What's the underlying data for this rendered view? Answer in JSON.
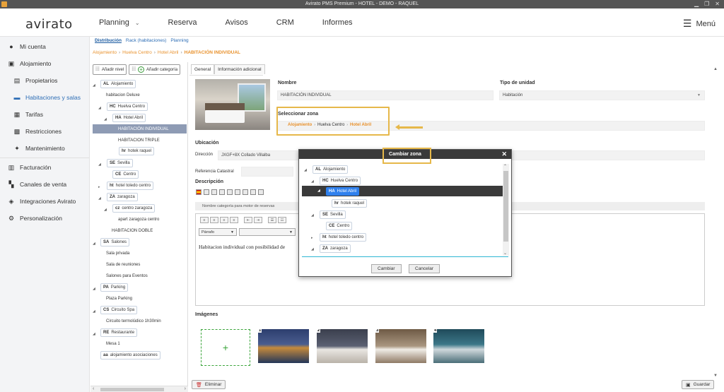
{
  "window": {
    "title": "Avirato PMS Premium - HOTEL - DEMO - RAQUEL"
  },
  "header": {
    "logo": "avirato",
    "nav": [
      "Planning",
      "Reserva",
      "Avisos",
      "CRM",
      "Informes"
    ],
    "menu_label": "Menú"
  },
  "sidebar": {
    "items": [
      {
        "label": "Mi cuenta",
        "icon": "user-icon"
      },
      {
        "label": "Alojamiento",
        "icon": "building-icon"
      },
      {
        "label": "Propietarios",
        "icon": "contact-icon"
      },
      {
        "label": "Habitaciones y salas",
        "icon": "bed-icon"
      },
      {
        "label": "Tarifas",
        "icon": "tariff-icon"
      },
      {
        "label": "Restricciones",
        "icon": "calendar-icon"
      },
      {
        "label": "Mantenimiento",
        "icon": "sparkle-icon"
      },
      {
        "label": "Facturación",
        "icon": "invoice-icon"
      },
      {
        "label": "Canales de venta",
        "icon": "grid-icon"
      },
      {
        "label": "Integraciones Avirato",
        "icon": "layers-icon"
      },
      {
        "label": "Personalización",
        "icon": "gear-icon"
      }
    ]
  },
  "subtabs": [
    "Distribución",
    "Rack (habitaciones)",
    "Planning"
  ],
  "breadcrumb": [
    "Alojamiento",
    "Huelva Centro",
    "Hotel Abril",
    "HABITACIÓN INDIVIDUAL"
  ],
  "tree": {
    "add_level": "Añadir nivel",
    "add_category": "Añadir categoría",
    "nodes": {
      "al": {
        "code": "AL",
        "label": "Alojamiento"
      },
      "hab_deluxe": "habitacion Deluxe",
      "hc": {
        "code": "HC",
        "label": "Huelva Centro"
      },
      "ha": {
        "code": "HA",
        "label": "Hotel Abril"
      },
      "hab_ind": "HABITACIÓN INDIVIDUAL",
      "hab_triple": "HABITACION TRIPLE",
      "hr": {
        "code": "hr",
        "label": "hotek raquel"
      },
      "se": {
        "code": "SE",
        "label": "Sevilla"
      },
      "ce": {
        "code": "CE",
        "label": "Centro"
      },
      "ht": {
        "code": "ht",
        "label": "hotel toledo centro"
      },
      "za": {
        "code": "ZA",
        "label": "zaragoza"
      },
      "cz": {
        "code": "cz",
        "label": "centro zaragoza"
      },
      "apart": "apart zaragoza centro",
      "hab_doble": "HABITACION DOBLE",
      "sa": {
        "code": "SA",
        "label": "Salones"
      },
      "sala_priv": "Sala privada",
      "sala_reun": "Sala de reuniones",
      "salones_ev": "Salones para Eventos",
      "pa": {
        "code": "PA",
        "label": "Parking"
      },
      "plaza": "Plaza Parking",
      "cs": {
        "code": "CS",
        "label": "Circuito Spa"
      },
      "circ_term": "Circuito termolúdico 1h30min",
      "re": {
        "code": "RE",
        "label": "Restaurante"
      },
      "mesa": "Mesa 1",
      "aa": {
        "code": "aa",
        "label": "alojamiento asociaciones"
      }
    }
  },
  "form": {
    "tabs": [
      "General",
      "Información adicional"
    ],
    "nombre_label": "Nombre",
    "nombre_value": "HABITACIÓN INDIVIDUAL",
    "tipo_label": "Tipo de unidad",
    "tipo_value": "Habitación",
    "zona_label": "Seleccionar zona",
    "zona_path": [
      "Alojamiento",
      "Huelva Centro",
      "Hotel Abril"
    ],
    "ubicacion_label": "Ubicación",
    "direccion_label": "Dirección",
    "direccion_value": "JXGF+8X Collado Villalba",
    "ref_label": "Referencia Catastral",
    "descripcion_label": "Descripción",
    "categoria_strip": "Nombre categoría para motor de reservas",
    "parrafo": "Párrafo",
    "desc_text": "Habitacion individual con posibilidad de",
    "imagenes_label": "Imágenes",
    "image_numbers": [
      "1",
      "2",
      "3",
      "4"
    ],
    "eliminar": "Eliminar",
    "guardar": "Guardar"
  },
  "modal": {
    "title": "Cambiar zona",
    "nodes": {
      "al": {
        "code": "AL",
        "label": "Alojamiento"
      },
      "hc": {
        "code": "HC",
        "label": "Huelva Centro"
      },
      "ha": {
        "code": "HA",
        "label": "Hotel Abril"
      },
      "hr": {
        "code": "hr",
        "label": "hotek raquel"
      },
      "se": {
        "code": "SE",
        "label": "Sevilla"
      },
      "ce": {
        "code": "CE",
        "label": "Centro"
      },
      "ht": {
        "code": "ht",
        "label": "hotel toledo centro"
      },
      "za": {
        "code": "ZA",
        "label": "zaragoza"
      }
    },
    "cambiar": "Cambiar",
    "cancelar": "Cancelar"
  },
  "colors": {
    "accent": "#2c6db5",
    "breadcrumb": "#e8912c",
    "annotation": "#e6b84a",
    "selected": "#2f80ed"
  }
}
